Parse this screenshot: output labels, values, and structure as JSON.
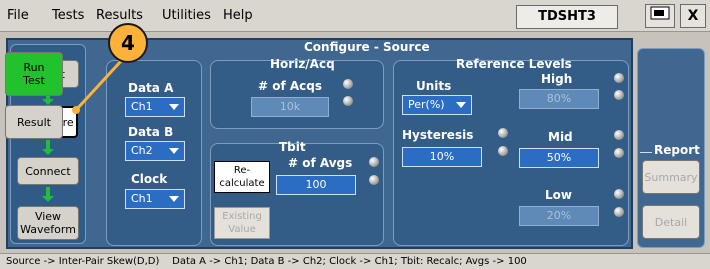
{
  "menubar": {
    "items": [
      "File",
      "Tests",
      "Results",
      "Utilities",
      "Help"
    ],
    "model": "TDSHT3",
    "close": "X"
  },
  "panel": {
    "title": "Configure - Source",
    "horiz": {
      "title": "Horiz/Acq",
      "acqs_label": "# of Acqs",
      "acqs_value": "10k"
    },
    "tbit": {
      "title": "Tbit",
      "recalc_label": "Re-\ncalculate",
      "avgs_label": "# of Avgs",
      "avgs_value": "100",
      "existing_label": "Existing\nValue"
    },
    "data_a": {
      "label": "Data A",
      "value": "Ch1"
    },
    "data_b": {
      "label": "Data B",
      "value": "Ch2"
    },
    "clock": {
      "label": "Clock",
      "value": "Ch1"
    },
    "ref": {
      "title": "Reference Levels",
      "units_label": "Units",
      "units_value": "Per(%)",
      "hysteresis_label": "Hysteresis",
      "hysteresis_value": "10%",
      "high_label": "High",
      "high_value": "80%",
      "mid_label": "Mid",
      "mid_value": "50%",
      "low_label": "Low",
      "low_value": "20%"
    }
  },
  "nav": {
    "select": "Select",
    "configure": "Configure",
    "connect": "Connect",
    "view": "View\nWaveform"
  },
  "right": {
    "run": "Run\nTest",
    "result": "Result",
    "report": "Report",
    "summary": "Summary",
    "detail": "Detail"
  },
  "status": "Source -> Inter-Pair Skew(D,D)    Data A -> Ch1; Data B -> Ch2; Clock -> Ch1; Tbit: Recalc; Avgs -> 100",
  "callout": "4",
  "colors": {
    "panel": "#3f6790",
    "accent_green": "#1fbf3b",
    "run_button": "#22c22e",
    "callout": "#ffb23a"
  }
}
